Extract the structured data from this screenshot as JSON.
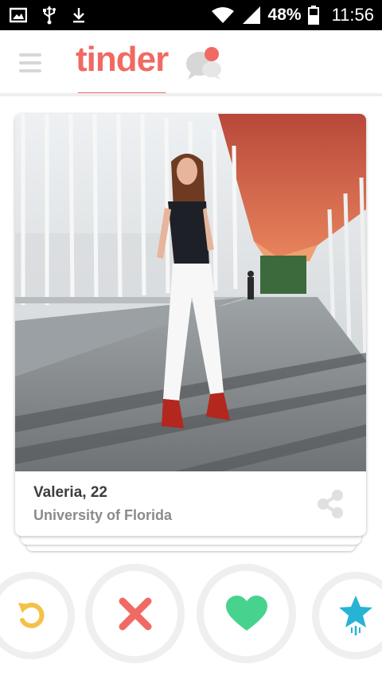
{
  "status_bar": {
    "icons": [
      "image-icon",
      "usb-icon",
      "download-icon",
      "wifi-icon",
      "signal-icon",
      "battery-icon"
    ],
    "battery": "48%",
    "time": "11:56"
  },
  "header": {
    "logo": "tinder",
    "menu_icon": "hamburger-menu-icon",
    "messages_icon": "chat-bubbles-icon",
    "active_tab": "tinder"
  },
  "profile": {
    "name_age": "Valeria, 22",
    "school": "University of Florida",
    "photo": "profile-photo"
  },
  "actions": [
    {
      "name": "rewind",
      "icon": "rewind-icon",
      "color": "#f4c24a"
    },
    {
      "name": "nope",
      "icon": "x-icon",
      "color": "#f06a63"
    },
    {
      "name": "like",
      "icon": "heart-icon",
      "color": "#47d38e"
    },
    {
      "name": "super-like",
      "icon": "star-icon",
      "color": "#27b3d6"
    }
  ],
  "colors": {
    "brand": "#f06a63",
    "nope": "#f06a63",
    "like": "#47d38e",
    "super_like": "#27b3d6",
    "rewind": "#f4c24a"
  }
}
